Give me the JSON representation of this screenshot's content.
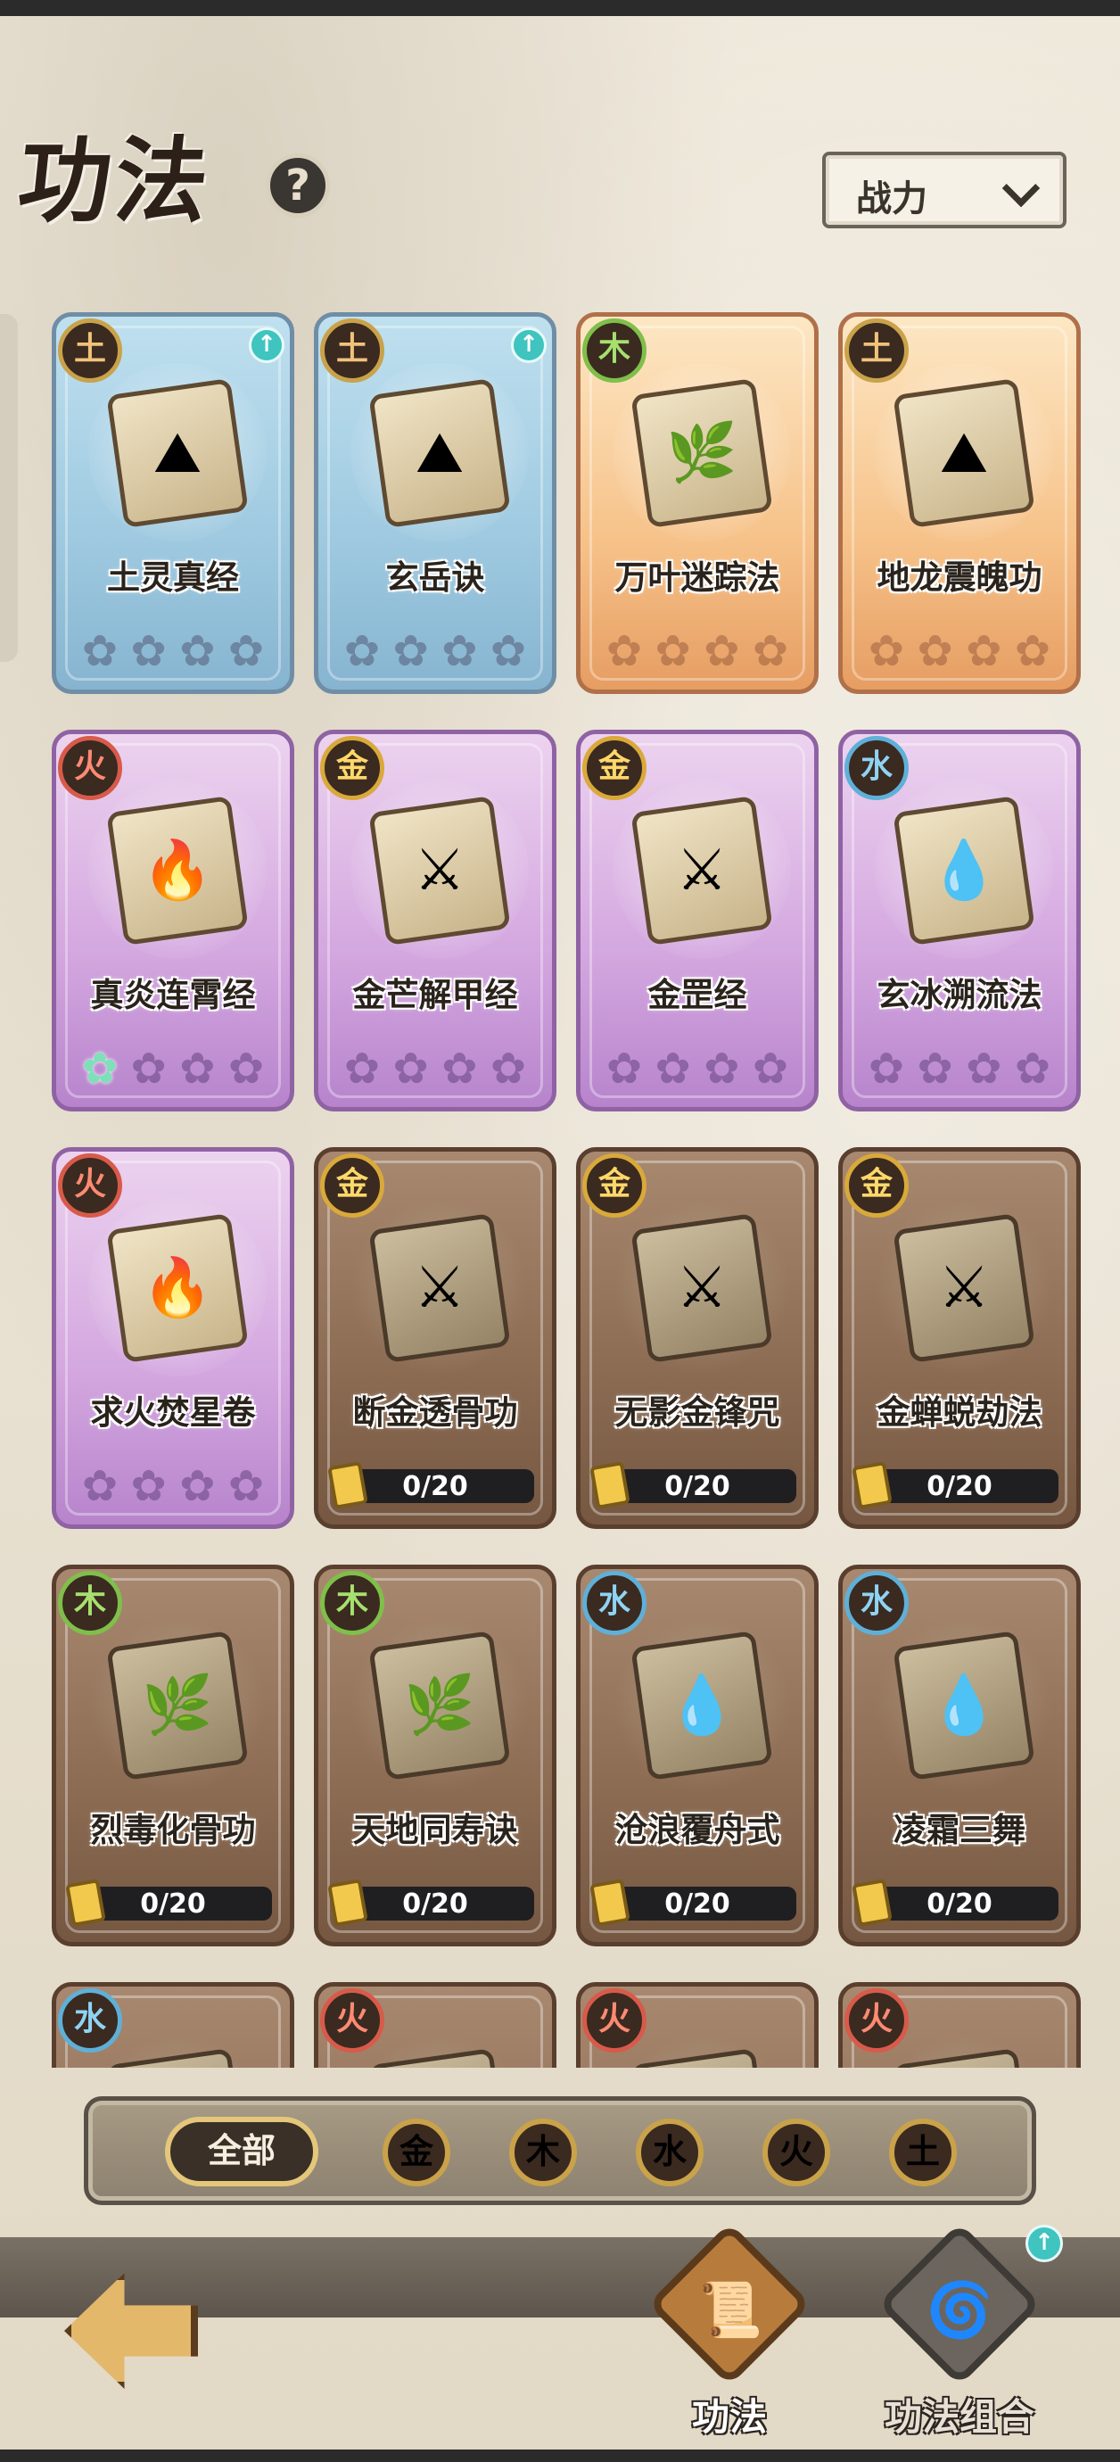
{
  "header": {
    "title": "功法",
    "help_icon": "?",
    "sort_select": {
      "selected": "战力"
    }
  },
  "colors": {
    "upgrade_accent": "#3fc4c0",
    "filter_selected_ring": "#e4c77a",
    "progress_bar_bg": "#1f1f22"
  },
  "cards": [
    {
      "name": "土灵真经",
      "element": "土",
      "rarity": "blue",
      "stars": 0,
      "max_stars": 4,
      "upgrade": true,
      "icon": "book-icon"
    },
    {
      "name": "玄岳诀",
      "element": "土",
      "rarity": "blue",
      "stars": 0,
      "max_stars": 4,
      "upgrade": true,
      "icon": "book-icon"
    },
    {
      "name": "万叶迷踪法",
      "element": "木",
      "rarity": "orange",
      "stars": 0,
      "max_stars": 4,
      "upgrade": false,
      "icon": "dragon-scroll-icon"
    },
    {
      "name": "地龙震魄功",
      "element": "土",
      "rarity": "orange",
      "stars": 0,
      "max_stars": 4,
      "upgrade": false,
      "icon": "dragon-scroll-icon"
    },
    {
      "name": "真炎连霄经",
      "element": "火",
      "rarity": "purple",
      "stars": 1,
      "max_stars": 4,
      "upgrade": false,
      "icon": "scroll-icon"
    },
    {
      "name": "金芒解甲经",
      "element": "金",
      "rarity": "purple",
      "stars": 0,
      "max_stars": 4,
      "upgrade": false,
      "icon": "scroll-icon"
    },
    {
      "name": "金罡经",
      "element": "金",
      "rarity": "purple",
      "stars": 0,
      "max_stars": 4,
      "upgrade": false,
      "icon": "scroll-icon"
    },
    {
      "name": "玄冰溯流法",
      "element": "水",
      "rarity": "purple",
      "stars": 0,
      "max_stars": 4,
      "upgrade": false,
      "icon": "scroll-icon"
    },
    {
      "name": "求火焚星卷",
      "element": "火",
      "rarity": "purple",
      "stars": 0,
      "max_stars": 4,
      "upgrade": false,
      "icon": "scroll-icon"
    },
    {
      "name": "断金透骨功",
      "element": "金",
      "rarity": "locked",
      "progress": "0/20",
      "progress_value": 0,
      "progress_max": 20,
      "icon": "dragon-scroll-icon"
    },
    {
      "name": "无影金锋咒",
      "element": "金",
      "rarity": "locked",
      "progress": "0/20",
      "progress_value": 0,
      "progress_max": 20,
      "icon": "dragon-scroll-icon"
    },
    {
      "name": "金蝉蜕劫法",
      "element": "金",
      "rarity": "locked",
      "progress": "0/20",
      "progress_value": 0,
      "progress_max": 20,
      "icon": "dragon-scroll-icon"
    },
    {
      "name": "烈毒化骨功",
      "element": "木",
      "rarity": "locked",
      "progress": "0/20",
      "progress_value": 0,
      "progress_max": 20,
      "icon": "dragon-scroll-icon"
    },
    {
      "name": "天地同寿诀",
      "element": "木",
      "rarity": "locked",
      "progress": "0/20",
      "progress_value": 0,
      "progress_max": 20,
      "icon": "dragon-scroll-icon"
    },
    {
      "name": "沧浪覆舟式",
      "element": "水",
      "rarity": "locked",
      "progress": "0/20",
      "progress_value": 0,
      "progress_max": 20,
      "icon": "dragon-scroll-icon"
    },
    {
      "name": "凌霜三舞",
      "element": "水",
      "rarity": "locked",
      "progress": "0/20",
      "progress_value": 0,
      "progress_max": 20,
      "icon": "dragon-scroll-icon"
    },
    {
      "name": "",
      "element": "水",
      "rarity": "locked",
      "partial": true,
      "icon": "dragon-scroll-icon"
    },
    {
      "name": "",
      "element": "火",
      "rarity": "locked",
      "partial": true,
      "icon": "dragon-scroll-icon"
    },
    {
      "name": "",
      "element": "火",
      "rarity": "locked",
      "partial": true,
      "icon": "dragon-scroll-icon"
    },
    {
      "name": "",
      "element": "火",
      "rarity": "locked",
      "partial": true,
      "icon": "dragon-scroll-icon"
    }
  ],
  "filters": {
    "all_label": "全部",
    "selected": "全部",
    "elements": [
      "金",
      "木",
      "水",
      "火",
      "土"
    ]
  },
  "bottom_nav": {
    "back_icon": "back-arrow-icon",
    "tabs": [
      {
        "label": "功法",
        "active": true,
        "icon": "scroll-badge-icon"
      },
      {
        "label": "功法组合",
        "active": false,
        "icon": "combo-badge-icon",
        "upgrade": true
      }
    ]
  }
}
